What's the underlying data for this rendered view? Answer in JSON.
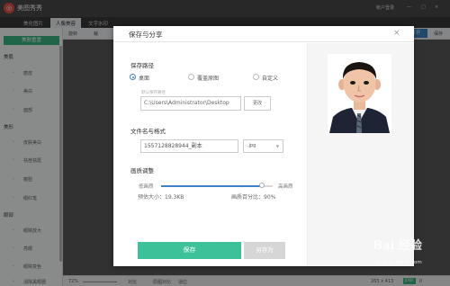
{
  "app": {
    "logo_glyph": "◎",
    "title": "美图秀秀",
    "account": "帐户登录",
    "window_controls": [
      "—",
      "□",
      "×"
    ]
  },
  "tabs": [
    {
      "label": "美化图片",
      "active": false
    },
    {
      "label": "人像美容",
      "active": true
    },
    {
      "label": "文字水印",
      "active": false
    }
  ],
  "toolbar": {
    "rotate": "旋转",
    "cut": "裁",
    "open": "打开",
    "save": "保存"
  },
  "sidebar": {
    "button": "美肤重置",
    "sections": [
      {
        "head": "美肌",
        "items": [
          "磨皮",
          "美白",
          "面部"
        ]
      },
      {
        "head": "美形",
        "items": [
          "皮肤美白",
          "祛痘祛斑",
          "瘦脸",
          "眼红笔"
        ]
      },
      {
        "head": "眼部",
        "items": [
          "眼睛放大",
          "亮眼",
          "眼睛变色",
          "消除黑眼圈"
        ]
      }
    ]
  },
  "status": {
    "zoom": "72%",
    "compare": "对比",
    "contrast": "原图对比",
    "fit": "适应",
    "size": "265 x 413",
    "badge": "EXIF",
    "info": "0"
  },
  "dialog": {
    "title": "保存与分享",
    "close": "×",
    "path_label": "保存路径",
    "radios": [
      {
        "label": "桌面",
        "checked": true
      },
      {
        "label": "覆盖原图",
        "checked": false
      },
      {
        "label": "自定义",
        "checked": false
      }
    ],
    "path_hint": "默认保存路径",
    "path_value": "C:\\Users\\Administrator\\Desktop",
    "change_button": "更改",
    "name_label": "文件名与格式",
    "file_name": "1557128828944_副本",
    "format": ".jpg",
    "format_arrow": "▼",
    "quality_label": "画质调整",
    "quality_low": "低画质",
    "quality_high": "高画质",
    "quality_percent": 90,
    "estimate": "预估大小：19.3KB",
    "quality_text": "画质百分比：90%",
    "save_button": "保存",
    "saveas_button": "另存为"
  },
  "watermark": {
    "text": "Bai 经验",
    "url": "jingyan.baidu.com"
  },
  "colors": {
    "accent": "#3c84c4",
    "save_green": "#3cc199",
    "side_green": "#3cb883",
    "photo_bg": "#ffffff",
    "shirt": "#1e2433"
  }
}
